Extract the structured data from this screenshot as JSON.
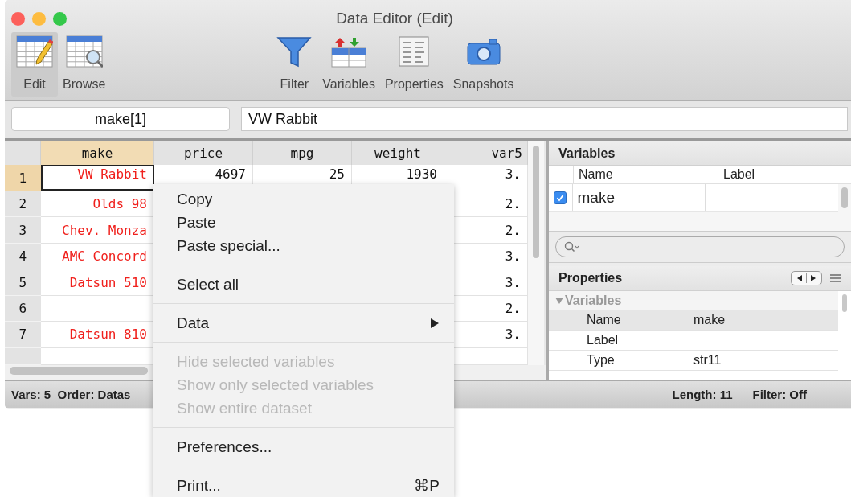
{
  "window": {
    "title": "Data Editor (Edit)"
  },
  "toolbar": [
    {
      "label": "Edit",
      "selected": true
    },
    {
      "label": "Browse",
      "selected": false
    },
    {
      "label": "Filter",
      "selected": false
    },
    {
      "label": "Variables",
      "selected": false
    },
    {
      "label": "Properties",
      "selected": false
    },
    {
      "label": "Snapshots",
      "selected": false
    }
  ],
  "cell_name_field": {
    "value": "make[1]"
  },
  "cell_value_field": {
    "value": "VW Rabbit"
  },
  "grid": {
    "columns": [
      {
        "name": "make",
        "selected": true,
        "kind": "string"
      },
      {
        "name": "price",
        "selected": false,
        "kind": "number"
      },
      {
        "name": "mpg",
        "selected": false,
        "kind": "number"
      },
      {
        "name": "weight",
        "selected": false,
        "kind": "number"
      },
      {
        "name": "var5",
        "selected": false,
        "kind": "number"
      }
    ],
    "rows": [
      {
        "number": "1",
        "selected": true,
        "make": "VW Rabbit",
        "price": "4697",
        "mpg": "25",
        "weight": "1930",
        "var5": "3."
      },
      {
        "number": "2",
        "selected": false,
        "make": "Olds 98",
        "var5": "2."
      },
      {
        "number": "3",
        "selected": false,
        "make": "Chev. Monza",
        "var5": "2."
      },
      {
        "number": "4",
        "selected": false,
        "make": "AMC Concord",
        "var5": "3."
      },
      {
        "number": "5",
        "selected": false,
        "make": "Datsun 510",
        "var5": "3."
      },
      {
        "number": "6",
        "selected": false,
        "var5": "2."
      },
      {
        "number": "7",
        "selected": false,
        "make": "Datsun 810",
        "var5": "3."
      }
    ]
  },
  "variables_panel": {
    "title": "Variables",
    "columns": [
      "Name",
      "Label"
    ],
    "rows": [
      {
        "name": "make",
        "checked": true
      }
    ]
  },
  "properties_panel": {
    "title": "Properties",
    "section": "Variables",
    "expanded": true,
    "rows": [
      {
        "name": "Name",
        "value": "make"
      },
      {
        "name": "Label"
      },
      {
        "name": "Type",
        "value": "str11"
      }
    ]
  },
  "status_bar": {
    "left": "Vars: 5  Order: Datas",
    "length": "Length: 11",
    "filter": "Filter: Off"
  },
  "context_menu": [
    {
      "kind": "item",
      "label": "Copy",
      "disabled": false
    },
    {
      "kind": "item",
      "label": "Paste",
      "disabled": false
    },
    {
      "kind": "item",
      "label": "Paste special...",
      "disabled": false
    },
    {
      "kind": "separator"
    },
    {
      "kind": "item",
      "label": "Select all",
      "disabled": false
    },
    {
      "kind": "separator"
    },
    {
      "kind": "item",
      "label": "Data",
      "disabled": false,
      "submenu": true
    },
    {
      "kind": "separator"
    },
    {
      "kind": "item",
      "label": "Hide selected variables",
      "disabled": true
    },
    {
      "kind": "item",
      "label": "Show only selected variables",
      "disabled": true
    },
    {
      "kind": "item",
      "label": "Show entire dataset",
      "disabled": true
    },
    {
      "kind": "separator"
    },
    {
      "kind": "item",
      "label": "Preferences...",
      "disabled": false
    },
    {
      "kind": "separator"
    },
    {
      "kind": "item",
      "label": "Print...",
      "disabled": false,
      "shortcut": "⌘P"
    }
  ]
}
